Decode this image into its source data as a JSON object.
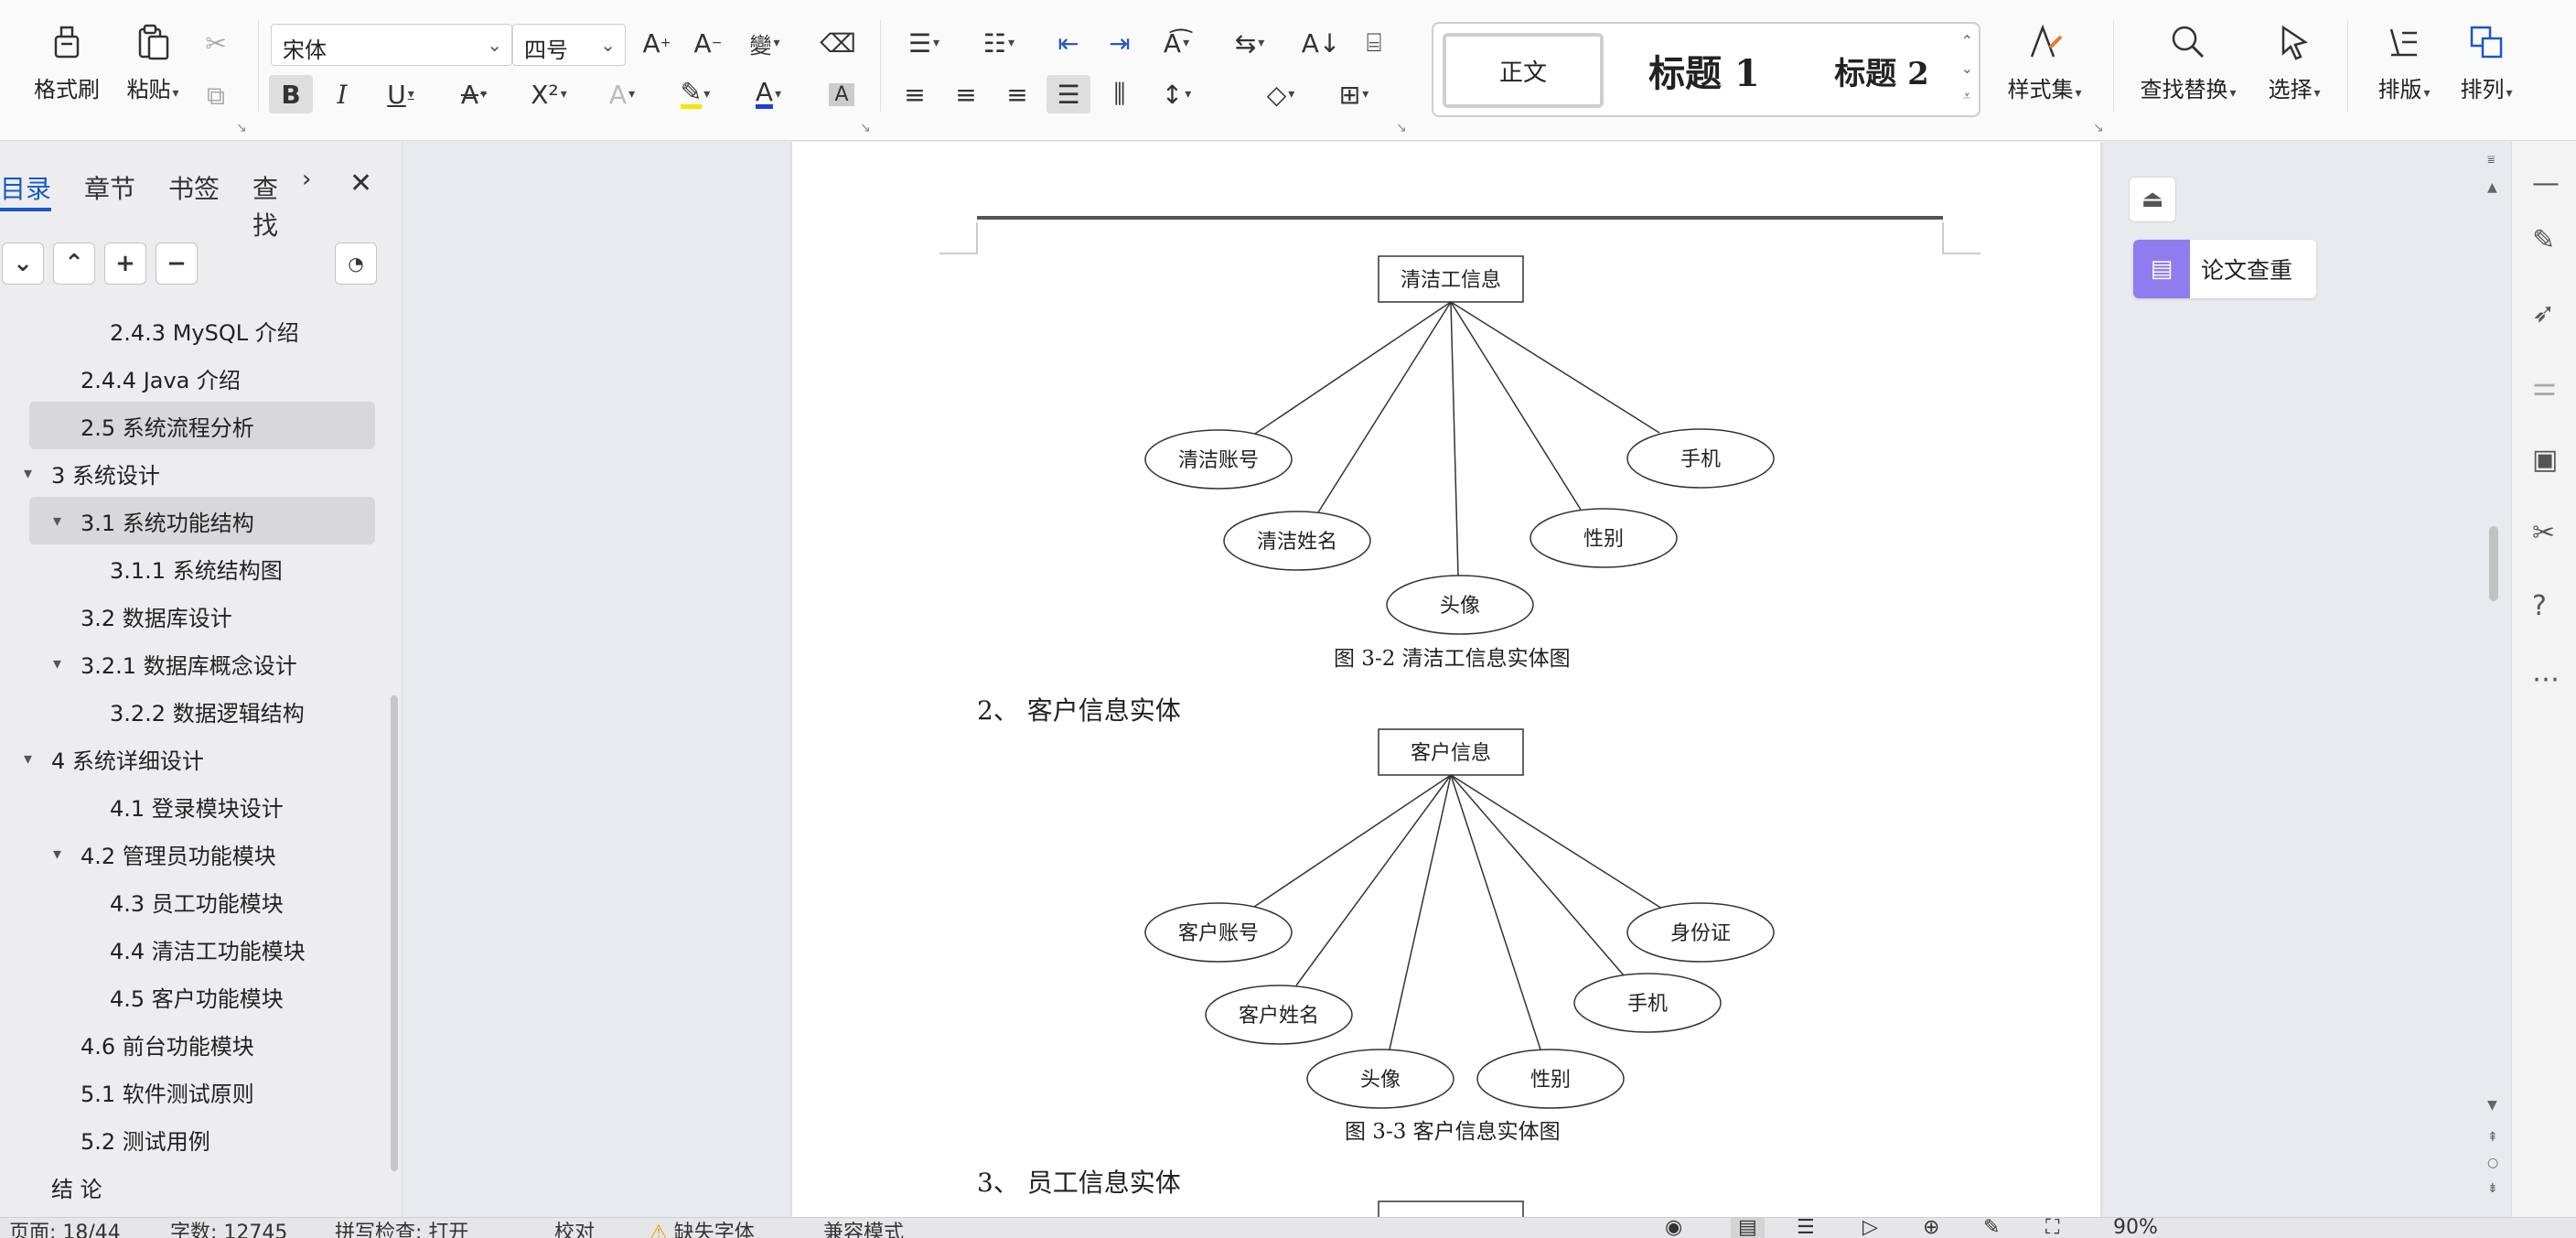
{
  "ribbon": {
    "format_painter": "格式刷",
    "paste": "粘贴",
    "font_name": "宋体",
    "font_size": "四号",
    "styles": {
      "normal": "正文",
      "heading1": "标题 1",
      "heading2": "标题 2"
    },
    "style_set": "样式集",
    "find_replace": "查找替换",
    "select": "选择",
    "layout": "排版",
    "arrange": "排列"
  },
  "nav": {
    "tabs": [
      "目录",
      "章节",
      "书签",
      "查找"
    ],
    "toc": [
      {
        "label": "2.4.3 MySQL 介绍",
        "level": 3
      },
      {
        "label": "2.4.4 Java 介绍",
        "level": 2
      },
      {
        "label": "2.5 系统流程分析",
        "level": 2,
        "selected": true
      },
      {
        "label": "3 系统设计",
        "level": 1,
        "expanded": true
      },
      {
        "label": "3.1 系统功能结构",
        "level": 2,
        "expanded": true,
        "selected": true
      },
      {
        "label": "3.1.1 系统结构图",
        "level": 3
      },
      {
        "label": "3.2 数据库设计",
        "level": 2
      },
      {
        "label": "3.2.1  数据库概念设计",
        "level": 2,
        "expanded": true
      },
      {
        "label": "3.2.2 数据逻辑结构",
        "level": 3
      },
      {
        "label": "4 系统详细设计",
        "level": 1,
        "expanded": true
      },
      {
        "label": "4.1 登录模块设计",
        "level": 3
      },
      {
        "label": "4.2 管理员功能模块",
        "level": 2,
        "expanded": true
      },
      {
        "label": "4.3  员工功能模块",
        "level": 3
      },
      {
        "label": "4.4  清洁工功能模块",
        "level": 3
      },
      {
        "label": "4.5  客户功能模块",
        "level": 3
      },
      {
        "label": "4.6  前台功能模块",
        "level": 2
      },
      {
        "label": "5.1 软件测试原则",
        "level": 2
      },
      {
        "label": "5.2 测试用例",
        "level": 2
      },
      {
        "label": "结  论",
        "level": 1
      }
    ]
  },
  "document": {
    "diagram1": {
      "entity": "清洁工信息",
      "attributes": [
        "清洁账号",
        "清洁姓名",
        "头像",
        "性别",
        "手机"
      ],
      "caption": "图 3-2 清洁工信息实体图"
    },
    "section2": "2、  客户信息实体",
    "diagram2": {
      "entity": "客户信息",
      "attributes": [
        "客户账号",
        "客户姓名",
        "头像",
        "性别",
        "手机",
        "身份证"
      ],
      "caption": "图 3-3 客户信息实体图"
    },
    "section3": "3、  员工信息实体"
  },
  "side_panel": {
    "paper_check": "论文查重"
  },
  "statusbar": {
    "page": "页面: 18/44",
    "words": "字数: 12745",
    "spell": "拼写检查: 打开",
    "proof": "校对",
    "missing_font": "缺失字体",
    "compat": "兼容模式",
    "zoom": "90%"
  }
}
